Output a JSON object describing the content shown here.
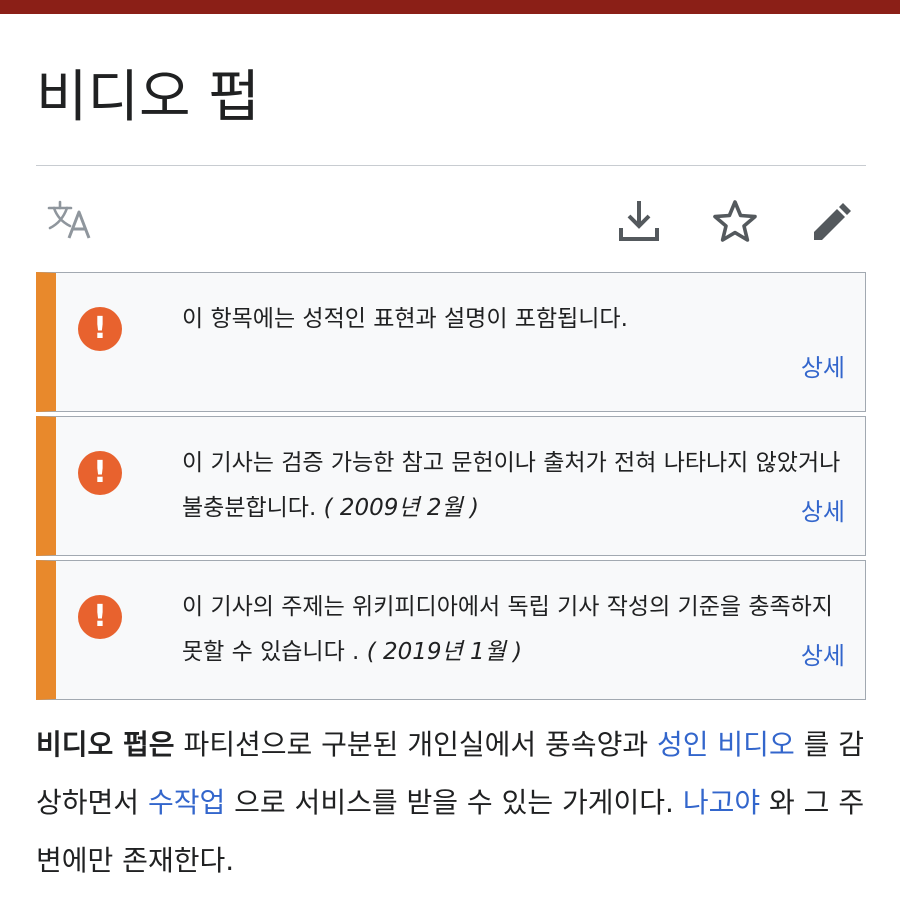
{
  "colors": {
    "top_bar": "#8b1f17",
    "notice_accent": "#e8892c",
    "warning_icon": "#e8622e",
    "link": "#3366cc"
  },
  "page": {
    "title": "비디오 펍"
  },
  "toolbar": {
    "language_icon": "translate-icon",
    "download_icon": "download-icon",
    "watch_icon": "star-icon",
    "edit_icon": "pencil-icon"
  },
  "notices": [
    {
      "text": "이 항목에는 성적인 표현과 설명이 포함됩니다.",
      "date": "",
      "more": "상세",
      "icon": "exclamation-icon"
    },
    {
      "text": "이 기사는 검증 가능한 참고 문헌이나 출처가 전혀 나타나지 않았거나 불충분합니다. ",
      "date": "( 2009년 2월 )",
      "more": "상세",
      "icon": "exclamation-icon"
    },
    {
      "text": "이 기사의 주제는 위키피디아에서 독립 기사 작성의 기준을 충족하지 못할 수 있습니다 . ",
      "date": "( 2019년 1월 )",
      "more": "상세",
      "icon": "exclamation-icon"
    }
  ],
  "body": {
    "bold": "비디오 펍은",
    "t1": " 파티션으로 구분된 개인실에서 풍속양과 ",
    "link1": "성인 비디오",
    "t2": " 를 감상하면서 ",
    "link2": "수작업",
    "t3": " 으로 서비스를 받을 수 있는 가게이다. ",
    "link3": "나고야",
    "t4": " 와 그 주변에만 존재한다."
  }
}
